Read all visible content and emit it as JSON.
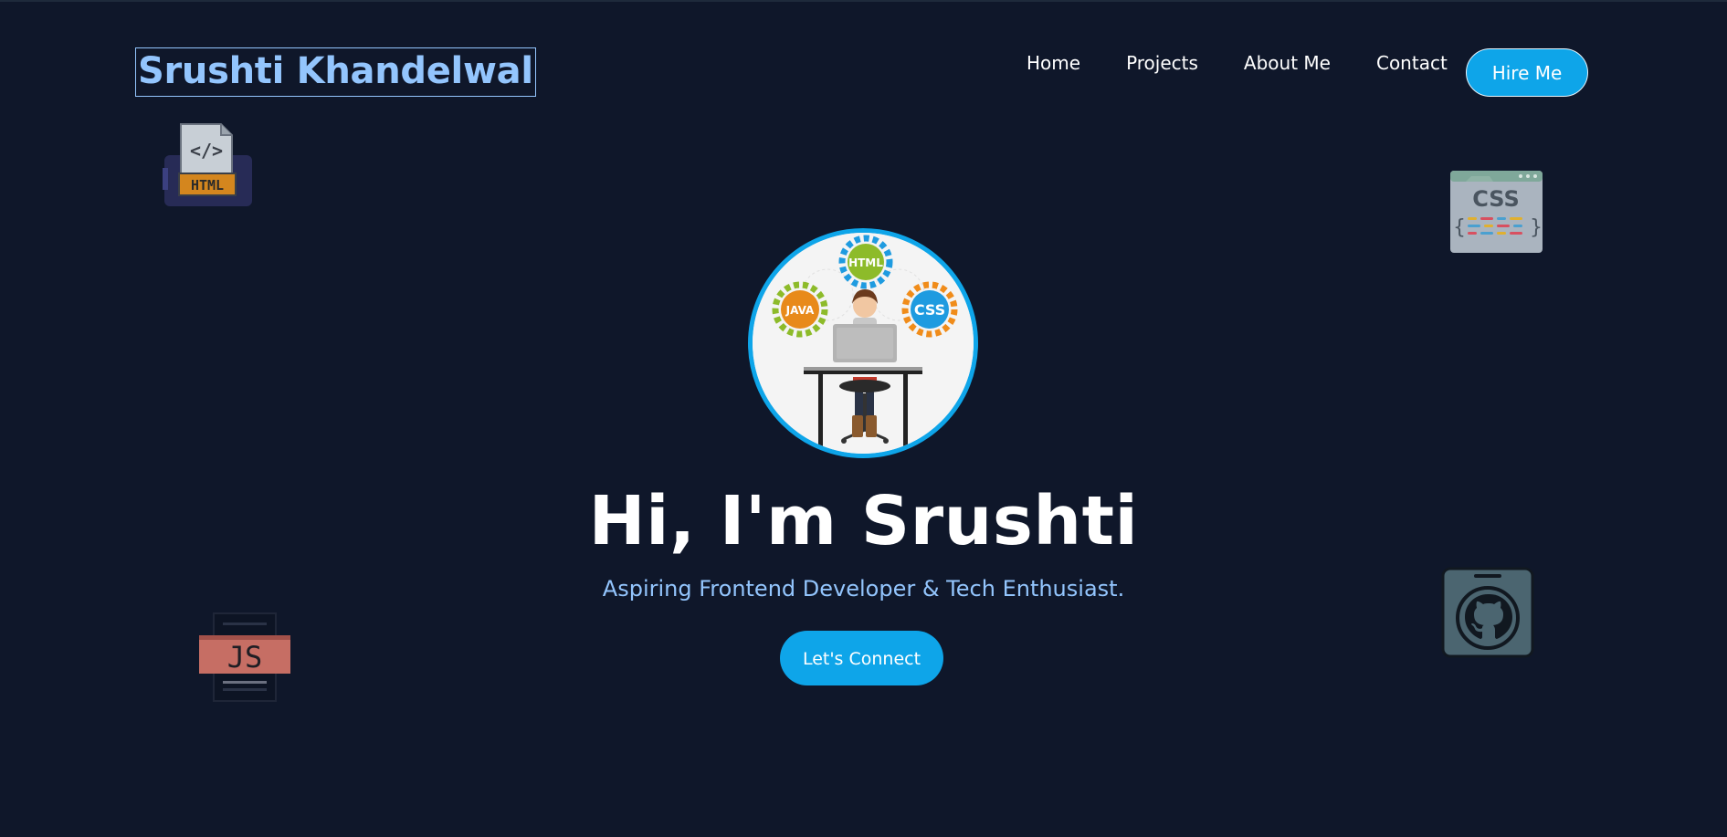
{
  "header": {
    "brand": "Srushti Khandelwal",
    "nav": [
      {
        "label": "Home"
      },
      {
        "label": "Projects"
      },
      {
        "label": "About Me"
      },
      {
        "label": "Contact"
      }
    ],
    "hire_label": "Hire Me"
  },
  "hero": {
    "title": "Hi, I'm Srushti",
    "subtitle": "Aspiring Frontend Developer & Tech Enthusiast.",
    "cta_label": "Let's Connect",
    "avatar": {
      "icon": "developer-illustration",
      "gear_labels": [
        "HTML",
        "JAVA",
        "CSS"
      ]
    }
  },
  "floating_icons": [
    {
      "icon": "html-file-icon",
      "label": "HTML"
    },
    {
      "icon": "css-code-icon",
      "label": "CSS"
    },
    {
      "icon": "js-file-icon",
      "label": "JS"
    },
    {
      "icon": "github-icon"
    }
  ],
  "colors": {
    "background": "#0f172a",
    "accent": "#0ea5e9",
    "brand_text": "#93c5fd",
    "text": "#ffffff"
  }
}
